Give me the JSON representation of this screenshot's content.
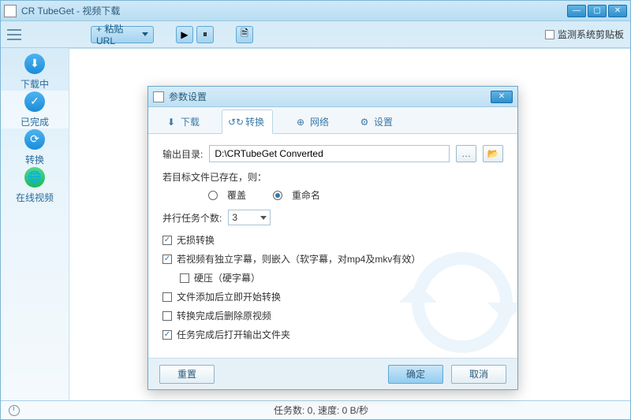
{
  "window": {
    "title": "CR TubeGet - 视频下载"
  },
  "toolbar": {
    "paste_url": "+ 粘贴URL",
    "monitor_clipboard": "监测系统剪贴板"
  },
  "sidebar": {
    "items": [
      {
        "label": "下载中"
      },
      {
        "label": "已完成"
      },
      {
        "label": "转换"
      },
      {
        "label": "在线视频"
      }
    ]
  },
  "dialog": {
    "title": "参数设置",
    "tabs": {
      "download": "下载",
      "convert": "转换",
      "network": "网络",
      "settings": "设置"
    },
    "output_label": "输出目录:",
    "output_path": "D:\\CRTubeGet Converted",
    "exists_label": "若目标文件已存在，则：",
    "overwrite": "覆盖",
    "rename": "重命名",
    "parallel_label": "并行任务个数:",
    "parallel_value": "3",
    "lossless": "无损转换",
    "subtitle_main": "若视频有独立字幕，则嵌入（软字幕，对mp4及mkv有效）",
    "subtitle_hard": "硬压（硬字幕）",
    "start_on_add": "文件添加后立即开始转换",
    "delete_source": "转换完成后删除原视频",
    "open_folder": "任务完成后打开输出文件夹",
    "reset": "重置",
    "ok": "确定",
    "cancel": "取消"
  },
  "status": {
    "text": "任务数: 0, 速度: 0 B/秒"
  }
}
